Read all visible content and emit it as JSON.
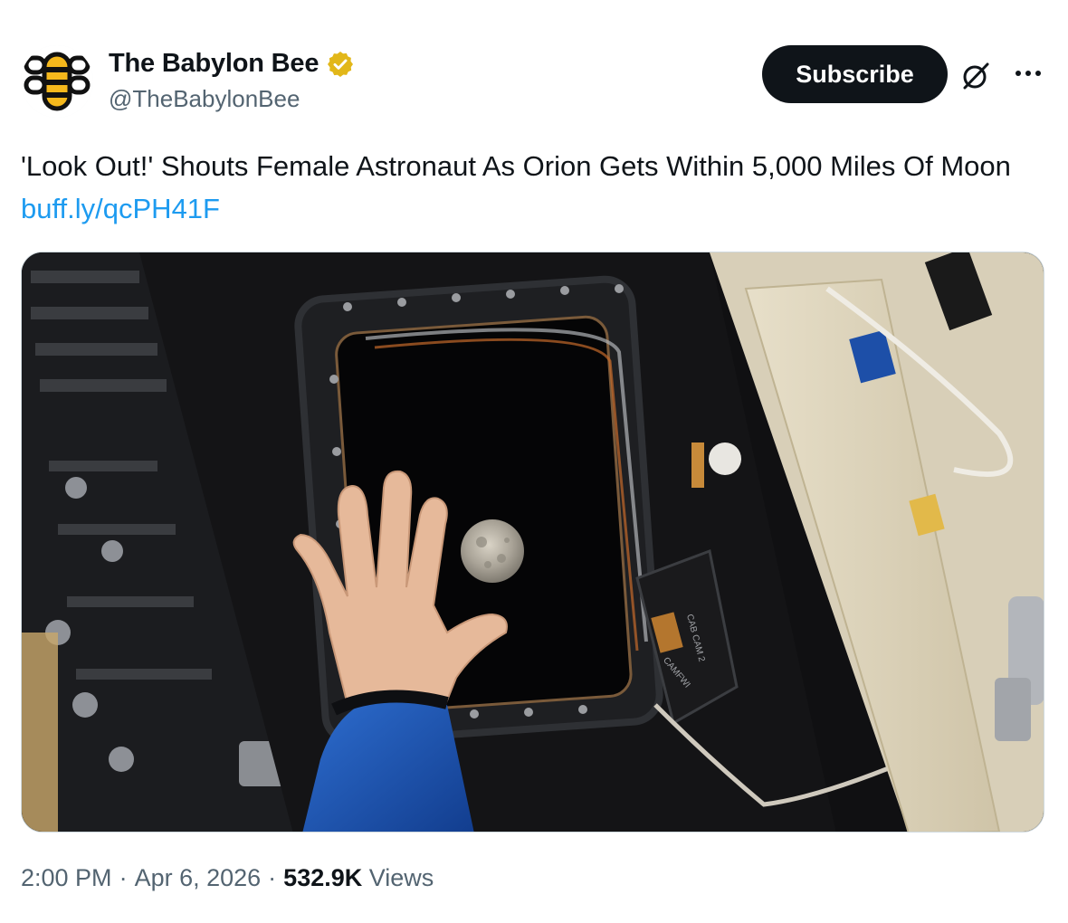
{
  "author": {
    "display_name": "The Babylon Bee",
    "handle": "@TheBabylonBee",
    "verified_icon": "verified-badge-icon",
    "avatar_icon": "babylon-bee-logo"
  },
  "actions": {
    "subscribe_label": "Subscribe",
    "grok_icon": "grok-icon",
    "more_icon": "more-options-icon"
  },
  "tweet": {
    "text": "'Look Out!' Shouts Female Astronaut As Orion Gets Within 5,000 Miles Of Moon",
    "link_text": "buff.ly/qcPH41F"
  },
  "media": {
    "camera_labels": [
      "CAB CAM 2",
      "CAMFWI"
    ]
  },
  "meta": {
    "time": "2:00 PM",
    "separator": "·",
    "date": "Apr 6, 2026",
    "views_count": "532.9K",
    "views_label": "Views"
  },
  "colors": {
    "link": "#1d9bf0",
    "button_bg": "#0f1419",
    "secondary_text": "#536471",
    "verified_gold": "#e2b719",
    "bee_yellow": "#f5b81c"
  }
}
